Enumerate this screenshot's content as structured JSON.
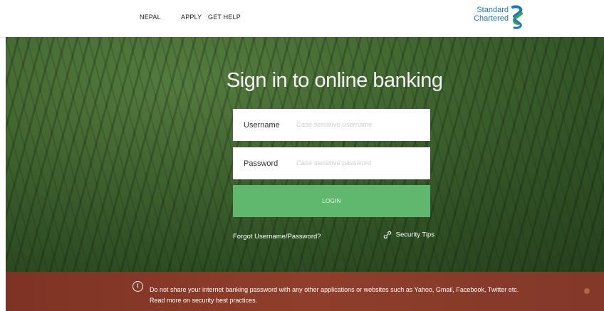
{
  "nav": {
    "country": "NEPAL",
    "apply": "APPLY",
    "help": "GET HELP"
  },
  "logo": {
    "line1": "Standard",
    "line2": "Chartered",
    "brand_blue": "#1976d2",
    "brand_green": "#38a845"
  },
  "login": {
    "title": "Sign in to online banking",
    "username_label": "Username",
    "username_placeholder": "Case sensitive username",
    "password_label": "Password",
    "password_placeholder": "Case sensitive password",
    "login_button": "LOGIN",
    "forgot_link": "Forgot Username/Password?",
    "security_tips": "Security Tips",
    "button_color": "#5fb86d"
  },
  "notice": {
    "icon": "alert-circle-icon",
    "message": "Do not share your internet banking password with any other applications or websites such as Yahoo, Gmail, Facebook, Twitter etc.",
    "read_more": "Read more on security best practices.",
    "background": "#8a3a2a"
  }
}
